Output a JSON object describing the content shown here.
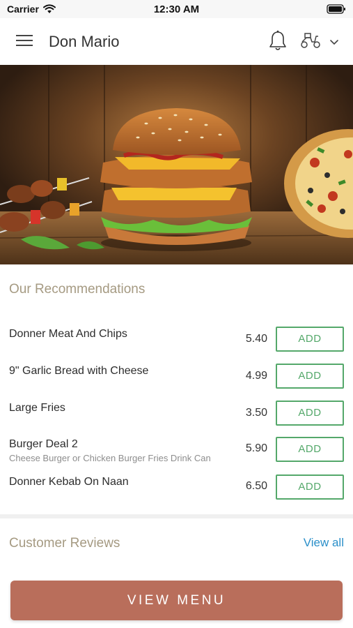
{
  "status_bar": {
    "carrier": "Carrier",
    "time": "12:30 AM"
  },
  "header": {
    "title": "Don Mario",
    "icons": [
      "menu-icon",
      "bell-icon",
      "delivery-scooter-icon",
      "chevron-down-icon"
    ]
  },
  "hero": {
    "icons": [
      "kebab-skewers",
      "chicken-burger",
      "pizza"
    ]
  },
  "recommendations": {
    "title": "Our Recommendations",
    "items": [
      {
        "name": "Donner Meat And Chips",
        "description": "",
        "price": "5.40",
        "add_label": "ADD"
      },
      {
        "name": "9\" Garlic Bread with Cheese",
        "description": "",
        "price": "4.99",
        "add_label": "ADD"
      },
      {
        "name": "Large Fries",
        "description": "",
        "price": "3.50",
        "add_label": "ADD"
      },
      {
        "name": "Burger Deal 2",
        "description": "Cheese Burger or Chicken Burger  Fries  Drink Can",
        "price": "5.90",
        "add_label": "ADD"
      },
      {
        "name": "Donner Kebab On Naan",
        "description": "",
        "price": "6.50",
        "add_label": "ADD"
      }
    ]
  },
  "reviews": {
    "title": "Customer Reviews",
    "view_all": "View all"
  },
  "footer": {
    "view_menu_label": "VIEW MENU"
  },
  "colors": {
    "accent_green": "#54a86a",
    "section_title": "#a59a82",
    "link_blue": "#2a8fc9",
    "menu_button": "#b96e5b"
  }
}
